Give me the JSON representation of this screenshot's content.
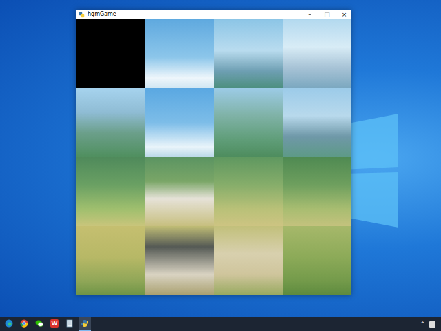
{
  "window": {
    "title": "hgmGame",
    "controls": [
      "–",
      "□",
      "×"
    ]
  },
  "puzzle": {
    "tiles": [
      {
        "empty": true
      },
      {
        "empty": false
      },
      {
        "empty": false
      },
      {
        "empty": false
      },
      {
        "empty": false
      },
      {
        "empty": false
      },
      {
        "empty": false
      },
      {
        "empty": false
      },
      {
        "empty": false
      },
      {
        "empty": false
      },
      {
        "empty": false
      },
      {
        "empty": false
      },
      {
        "empty": false
      },
      {
        "empty": false
      },
      {
        "empty": false
      },
      {
        "empty": false
      }
    ]
  },
  "taskbar": {
    "apps": [
      {
        "kind": "edge",
        "label": "",
        "active": false
      },
      {
        "kind": "chrome",
        "label": "",
        "active": false
      },
      {
        "kind": "wechat",
        "label": "",
        "active": false
      },
      {
        "kind": "wps",
        "label": "W",
        "active": false
      },
      {
        "kind": "notepad",
        "label": "",
        "active": false
      },
      {
        "kind": "python",
        "label": "",
        "active": true
      }
    ],
    "tray": [
      "^"
    ]
  }
}
